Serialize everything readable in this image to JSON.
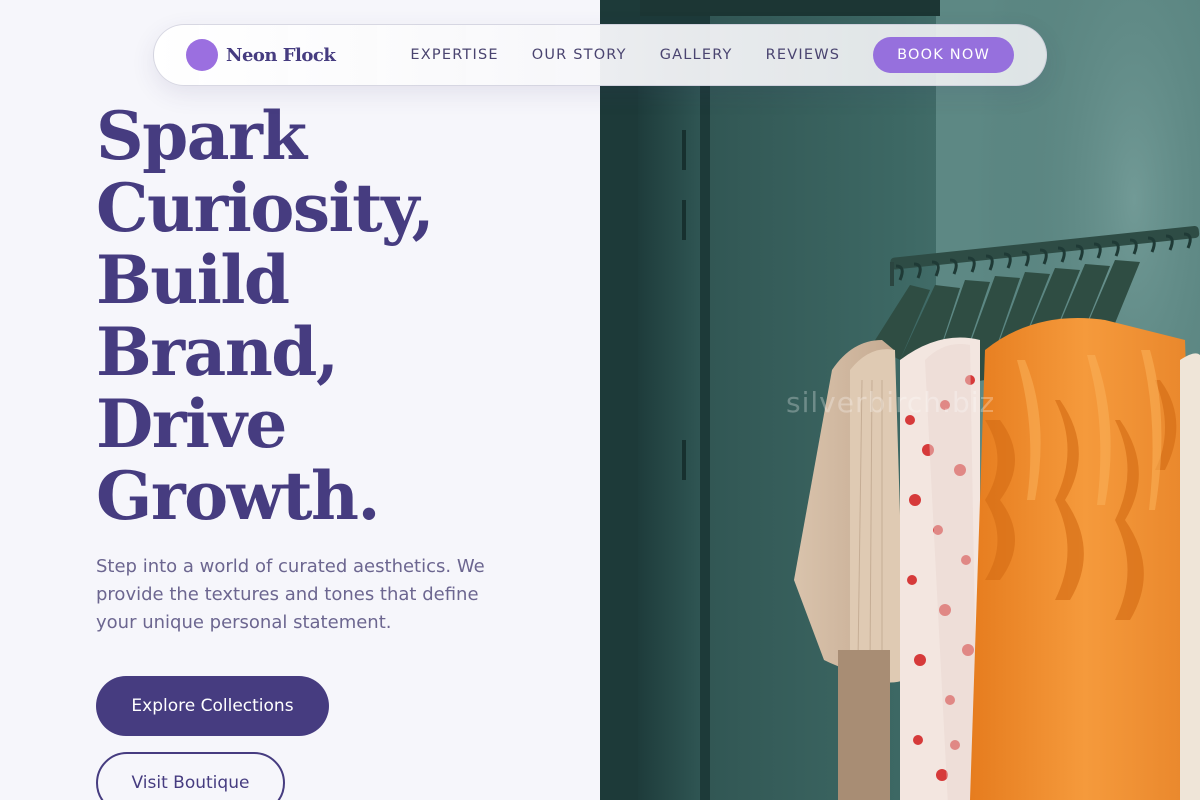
{
  "brand": {
    "name": "Neon Flock",
    "color": "#9b6fe0"
  },
  "nav": {
    "links": [
      "EXPERTISE",
      "OUR STORY",
      "GALLERY",
      "REVIEWS"
    ],
    "cta_label": "BOOK NOW"
  },
  "hero": {
    "title_lines": [
      "Spark",
      "Curiosity,",
      "Build",
      "Brand,",
      "Drive",
      "Growth."
    ],
    "description": "Step into a world of curated aesthetics. We provide the textures and tones that define your unique personal statement.",
    "primary_button": "Explore Collections",
    "secondary_button": "Visit Boutique"
  },
  "photo": {
    "subject": "clothing rack with beige, floral and orange garments",
    "watermark": "silverbirch.biz"
  },
  "colors": {
    "primary": "#463c80",
    "accent": "#9670dd",
    "background": "#f6f6fb"
  }
}
